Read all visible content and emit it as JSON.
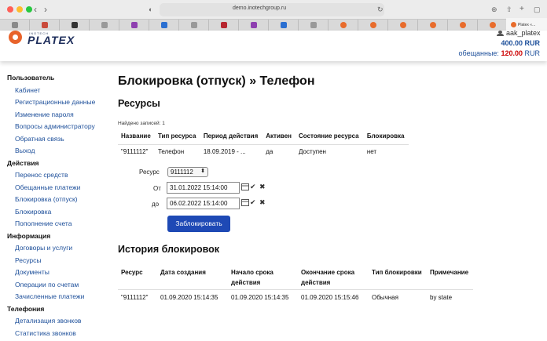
{
  "browser": {
    "url": "demo.inotechgroup.ru",
    "active_tab_title": "Platex «..."
  },
  "header": {
    "logo_small": "INOTECH",
    "logo_text": "PLATEX",
    "user_name": "aak_platex",
    "balance": "400.00 RUR",
    "promised_label": "обещанные:",
    "promised_amount": "120.00",
    "promised_currency": "RUR"
  },
  "sidebar": {
    "sections": [
      {
        "title": "Пользователь",
        "items": [
          "Кабинет",
          "Регистрационные данные",
          "Изменение пароля",
          "Вопросы администратору",
          "Обратная связь",
          "Выход"
        ]
      },
      {
        "title": "Действия",
        "items": [
          "Перенос средств",
          "Обещанные платежи",
          "Блокировка (отпуск)",
          "Блокировка",
          "Пополнение счета"
        ]
      },
      {
        "title": "Информация",
        "items": [
          "Договоры и услуги",
          "Ресурсы",
          "Документы",
          "Операции по счетам",
          "Зачисленные платежи"
        ]
      },
      {
        "title": "Телефония",
        "items": [
          "Детализация звонков",
          "Статистика звонков"
        ]
      }
    ]
  },
  "main": {
    "title": "Блокировка (отпуск) » Телефон",
    "resources_title": "Ресурсы",
    "found_text": "Найдено записей: 1",
    "resources_table": {
      "headers": [
        "Название",
        "Тип ресурса",
        "Период действия",
        "Активен",
        "Состояние ресурса",
        "Блокировка"
      ],
      "rows": [
        [
          "\"9111112\"",
          "Телефон",
          "18.09.2019 - ...",
          "да",
          "Доступен",
          "нет"
        ]
      ]
    },
    "form": {
      "resource_label": "Ресурс",
      "resource_value": "9111112",
      "from_label": "От",
      "from_value": "31.01.2022 15:14:00",
      "to_label": "до",
      "to_value": "06.02.2022 15:14:00",
      "submit_label": "Заблокировать"
    },
    "history_title": "История блокировок",
    "history_table": {
      "headers": [
        "Ресурс",
        "Дата создания",
        "Начало срока действия",
        "Окончание срока действия",
        "Тип блокировки",
        "Примечание"
      ],
      "rows": [
        [
          "\"9111112\"",
          "01.09.2020 15:14:35",
          "01.09.2020 15:14:35",
          "01.09.2020 15:15:46",
          "Обычная",
          "by state"
        ]
      ]
    }
  },
  "colors": {
    "link": "#1d4f9a",
    "button": "#1e49b5",
    "accent": "#e8632b",
    "promised": "#cc0000"
  }
}
